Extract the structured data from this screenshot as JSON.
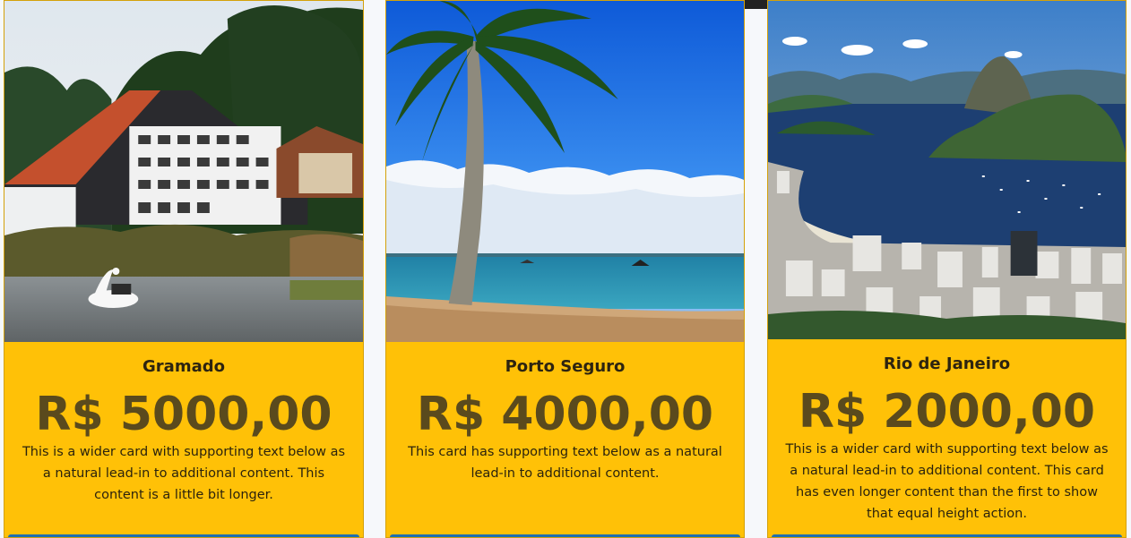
{
  "cards": [
    {
      "title": "Gramado",
      "price": "R$ 5000,00",
      "text": "This is a wider card with supporting text below as a natural lead-in to additional content. This content is a little bit longer.",
      "image_icon": "gramado-lakeside-hotel-photo"
    },
    {
      "title": "Porto Seguro",
      "price": "R$ 4000,00",
      "text": "This card has supporting text below as a natural lead-in to additional content.",
      "image_icon": "beach-palm-tree-photo"
    },
    {
      "title": "Rio de Janeiro",
      "price": "R$ 2000,00",
      "text": "This is a wider card with supporting text below as a natural lead-in to additional content. This card has even longer content than the first to show that equal height action.",
      "image_icon": "rio-sugarloaf-photo"
    }
  ],
  "colors": {
    "card_background": "#ffc107",
    "price_text": "#5a4a1d",
    "page_background": "#f6f8fb",
    "button_accent": "#1f6fb0"
  }
}
